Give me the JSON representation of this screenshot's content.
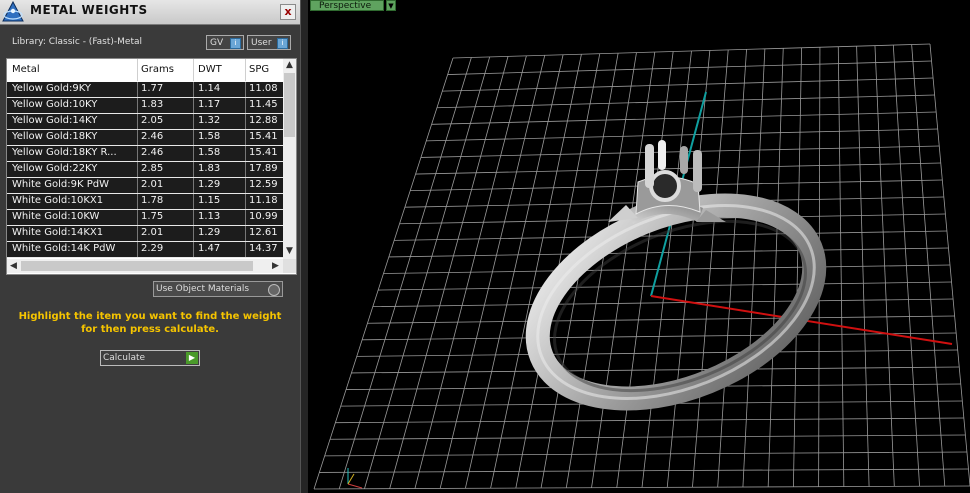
{
  "panel": {
    "title": "METAL WEIGHTS",
    "close_label": "x",
    "library": "Library: Classic - (Fast)-Metal",
    "filter_gv": "GV",
    "filter_user": "User",
    "use_object_materials": "Use Object Materials",
    "hint": "Highlight the item you want to find the weight for then press calculate.",
    "calculate": "Calculate"
  },
  "table": {
    "headers": {
      "metal": "Metal",
      "grams": "Grams",
      "dwt": "DWT",
      "spg": "SPG"
    },
    "rows": [
      {
        "metal": "Yellow Gold:9KY",
        "grams": "1.77",
        "dwt": "1.14",
        "spg": "11.08"
      },
      {
        "metal": "Yellow Gold:10KY",
        "grams": "1.83",
        "dwt": "1.17",
        "spg": "11.45"
      },
      {
        "metal": "Yellow Gold:14KY",
        "grams": "2.05",
        "dwt": "1.32",
        "spg": "12.88"
      },
      {
        "metal": "Yellow Gold:18KY",
        "grams": "2.46",
        "dwt": "1.58",
        "spg": "15.41"
      },
      {
        "metal": "Yellow Gold:18KY R...",
        "grams": "2.46",
        "dwt": "1.58",
        "spg": "15.41"
      },
      {
        "metal": "Yellow Gold:22KY",
        "grams": "2.85",
        "dwt": "1.83",
        "spg": "17.89"
      },
      {
        "metal": "White Gold:9K PdW",
        "grams": "2.01",
        "dwt": "1.29",
        "spg": "12.59"
      },
      {
        "metal": "White Gold:10KX1",
        "grams": "1.78",
        "dwt": "1.15",
        "spg": "11.18"
      },
      {
        "metal": "White Gold:10KW",
        "grams": "1.75",
        "dwt": "1.13",
        "spg": "10.99"
      },
      {
        "metal": "White Gold:14KX1",
        "grams": "2.01",
        "dwt": "1.29",
        "spg": "12.61"
      },
      {
        "metal": "White Gold:14K PdW",
        "grams": "2.29",
        "dwt": "1.47",
        "spg": "14.37"
      }
    ]
  },
  "viewport": {
    "view_mode": "Perspective",
    "axis_colors": {
      "x": "#d01010",
      "y": "#0fa0a0"
    },
    "grid_color": "#9a9a9a"
  }
}
